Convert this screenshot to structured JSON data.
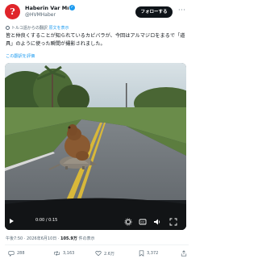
{
  "author": {
    "name": "Haberin Var Mı?",
    "handle": "@HVMHaber",
    "avatar_letter": "?"
  },
  "follow_label": "フォローする",
  "more_icon": "more-horizontal-icon",
  "translation": {
    "note": "トルコ語からの翻訳 ",
    "link": "原文を表示"
  },
  "tweet": {
    "text": "皆と仲良くすることが知られているカピバラが、今回はアルマジロをまるで「道具」のように使った瞬間が撮影されました。"
  },
  "rate_translation": "この翻訳を評価",
  "video": {
    "time": "0:00 / 0:15",
    "play_icon": "play-icon",
    "settings_icon": "settings-icon",
    "cc_icon": "cc-icon",
    "volume_icon": "volume-icon",
    "fullscreen_icon": "fullscreen-icon"
  },
  "meta": {
    "time_date": "午後7:50 · 2026年6月10日 · ",
    "views_count": "105.9万",
    "views_label": " 件の表示"
  },
  "actions": {
    "replies": "288",
    "reposts": "3,163",
    "likes": "2.6万",
    "bookmarks": "3,372"
  },
  "colors": {
    "accent": "#1d9bf0",
    "avatar_bg": "#e0252a",
    "button_bg": "#0f1419"
  }
}
